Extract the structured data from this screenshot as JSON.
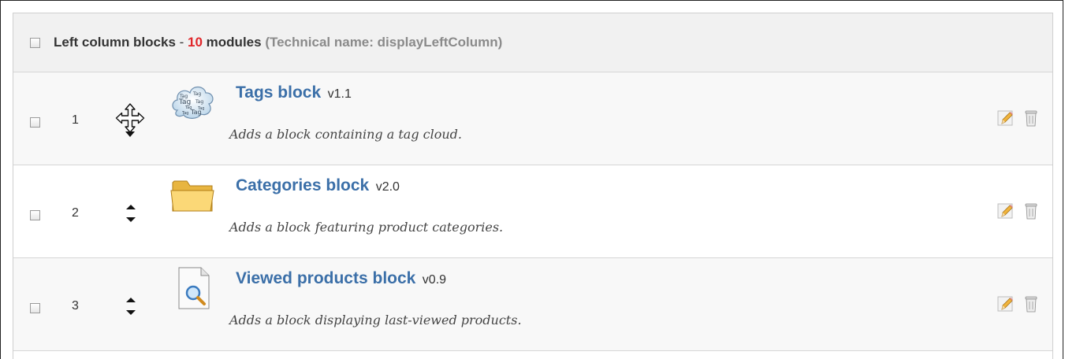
{
  "hook": {
    "title": "Left column blocks",
    "separator": " - ",
    "count": "10",
    "count_suffix": " modules",
    "technical_name": "(Technical name: displayLeftColumn)"
  },
  "colors": {
    "accent_link": "#3b6fa8",
    "count_red": "#e0262a",
    "header_bg": "#f1f1f1"
  },
  "modules": [
    {
      "position": "1",
      "name": "Tags block",
      "version": "v1.1",
      "description": "Adds a block containing a tag cloud.",
      "icon": "tag-cloud-icon",
      "reorder_control": "move-icon"
    },
    {
      "position": "2",
      "name": "Categories block",
      "version": "v2.0",
      "description": "Adds a block featuring product categories.",
      "icon": "folder-icon",
      "reorder_control": "up-down-arrows-icon"
    },
    {
      "position": "3",
      "name": "Viewed products block",
      "version": "v0.9",
      "description": "Adds a block displaying last-viewed products.",
      "icon": "document-search-icon",
      "reorder_control": "up-down-arrows-icon"
    }
  ],
  "row_actions": [
    "edit-pencil-icon",
    "delete-trash-icon"
  ]
}
